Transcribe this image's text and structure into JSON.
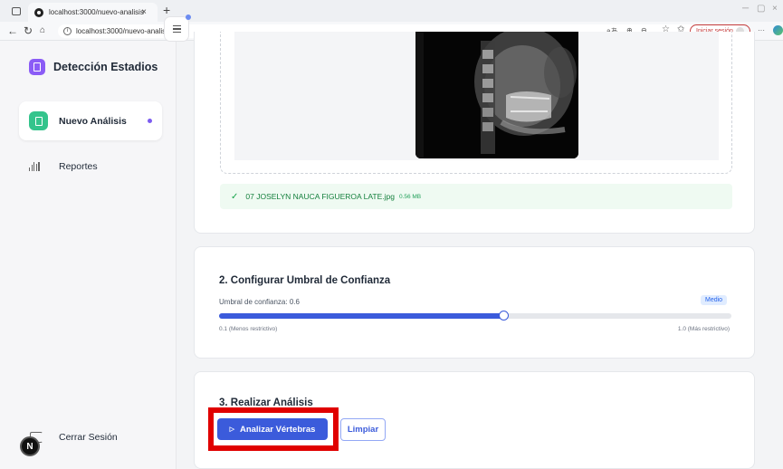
{
  "browser": {
    "tab_title": "localhost:3000/nuevo-analisis",
    "tab_close": "×",
    "new_tab": "+",
    "url": "localhost:3000/nuevo-analisis",
    "signin_label": "Iniciar sesión",
    "minimize": "─",
    "restore": "▢",
    "more": "···"
  },
  "sidebar": {
    "brand_title": "Detección Estadios",
    "items": [
      {
        "label": "Nuevo Análisis",
        "active": true
      },
      {
        "label": "Reportes",
        "active": false
      }
    ],
    "logout_label": "Cerrar Sesión",
    "avatar_letter": "N"
  },
  "upload": {
    "file_name": "07 JOSELYN NAUCA FIGUEROA LATE.jpg",
    "file_size": "0.56 MB",
    "check_icon": "✓"
  },
  "threshold": {
    "title": "2. Configurar Umbral de Confianza",
    "label": "Umbral de confianza: 0.6",
    "badge": "Medio",
    "value": 0.6,
    "min": 0.1,
    "max": 1.0,
    "min_label": "0.1 (Menos restrictivo)",
    "max_label": "1.0 (Más restrictivo)"
  },
  "analysis": {
    "title": "3. Realizar Análisis",
    "analyze_button": "Analizar Vértebras",
    "clear_button": "Limpiar"
  },
  "colors": {
    "accent": "#3b5bdb",
    "brand_icon": "#8b5cf6",
    "active_nav_icon": "#34c48c",
    "success_bg": "#effaf2",
    "highlight": "#e00000"
  }
}
